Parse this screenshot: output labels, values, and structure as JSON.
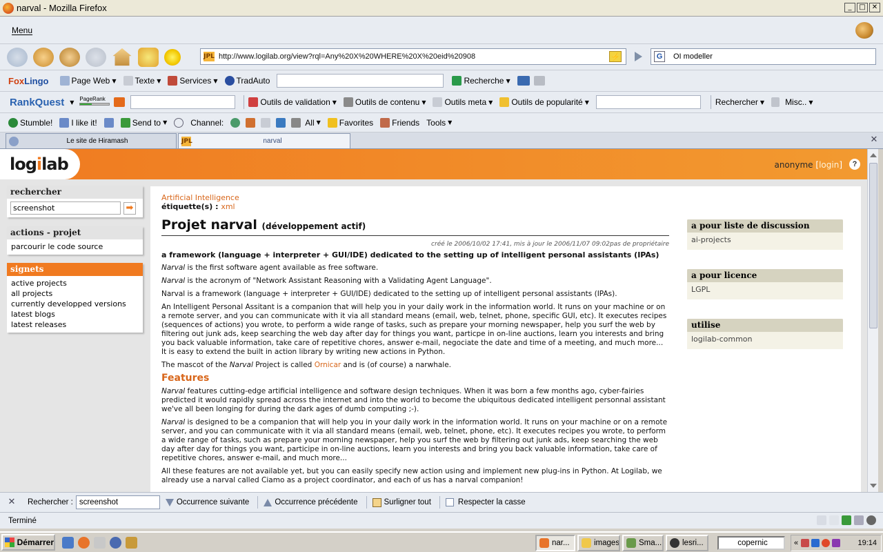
{
  "window": {
    "title": "narval - Mozilla Firefox",
    "btn_min": "_",
    "btn_max": "□",
    "btn_close": "✕"
  },
  "menubar": {
    "menu_label": "Menu"
  },
  "navbar": {
    "url": "http://www.logilab.org/view?rql=Any%20X%20WHERE%20X%20eid%20908",
    "url_favicon": "JPL",
    "lightning": "⚡",
    "search_engine": "G",
    "search_text": "OI modeller"
  },
  "toolbar1": {
    "foxlingo_a": "Fox",
    "foxlingo_b": "Lingo",
    "items": [
      "Page Web",
      "Texte",
      "Services",
      "TradAuto"
    ],
    "recherche": "Recherche"
  },
  "toolbar2": {
    "rankquest": "RankQuest",
    "pagerank": "PageRank",
    "items": [
      "Outils de validation",
      "Outils de contenu",
      "Outils meta",
      "Outils de popularité"
    ],
    "rechercher": "Rechercher",
    "misc": "Misc.."
  },
  "toolbar3": {
    "stumble": "Stumble!",
    "ilike": "I like it!",
    "sendto": "Send to",
    "channel": "Channel:",
    "all": "All",
    "favorites": "Favorites",
    "friends": "Friends",
    "tools": "Tools"
  },
  "tabs": [
    {
      "label": "Le site de Hiramash"
    },
    {
      "label": "narval",
      "favicon": "JPL"
    }
  ],
  "site": {
    "logo_a": "log",
    "logo_i": "i",
    "logo_b": "lab",
    "user": "anonyme",
    "open_bracket": "[",
    "login": "login",
    "close_bracket": "]",
    "help": "?"
  },
  "sidebar": {
    "search_title": "rechercher",
    "search_value": "screenshot",
    "search_go": "➡",
    "actions_title": "actions - projet",
    "actions": [
      "parcourir le code source"
    ],
    "signets_title": "signets",
    "signets": [
      "active projects",
      "all projects",
      "currently developped versions",
      "latest blogs",
      "latest releases"
    ]
  },
  "article": {
    "category": "Artificial Intelligence",
    "tags_label": "étiquette(s) :",
    "tags_value": "xml",
    "title": "Projet narval",
    "state": "(développement actif)",
    "meta": "créé le 2006/10/02 17:41, mis à jour le 2006/11/07 09:02pas de propriétaire",
    "summary": "a framework (language + interpreter + GUI/IDE) dedicated to the setting up of intelligent personal assistants (IPAs)",
    "p1_em": "Narval",
    "p1_rest": " is the first software agent available as free software.",
    "p2_em": "Narval",
    "p2_rest": " is the acronym of \"Network Assistant Reasoning with a Validating Agent Language\".",
    "p3": "Narval is a framework (language + interpreter + GUI/IDE) dedicated to the setting up of intelligent personal assistants (IPAs).",
    "p4": "An Intelligent Personal Assitant is a companion that will help you in your daily work in the information world. It runs on your machine or on a remote server, and you can communicate with it via all standard means (email, web, telnet, phone, specific GUI, etc). It executes recipes (sequences of actions) you wrote, to perform a wide range of tasks, such as prepare your morning newspaper, help you surf the web by filtering out junk ads, keep searching the web day after day for things you want, particpe in on-line auctions, learn you interests and bring you back valuable information, take care of repetitive chores, answer e-mail, negociate the date and time of a meeting, and much more... It is easy to extend the built in action library by writing new actions in Python.",
    "p5_a": "The mascot of the ",
    "p5_em": "Narval",
    "p5_b": " Project is called ",
    "p5_link": "Ornicar",
    "p5_c": " and is (of course) a narwhale.",
    "features_title": "Features",
    "f1_em": "Narval",
    "f1_rest": " features cutting-edge artificial intelligence and software design techniques. When it was born a few months ago, cyber-fairies predicted it would rapidly spread across the internet and into the world to become the ubiquitous dedicated intelligent personnal assistant we've all been longing for during the dark ages of dumb computing ;-).",
    "f2_em": "Narval",
    "f2_rest": " is designed to be a companion that will help you in your daily work in the information world. It runs on your machine or on a remote server, and you can communicate with it via all standard means (email, web, telnet, phone, etc). It executes recipes you wrote, to perform a wide range of tasks, such as prepare your morning newspaper, help you surf the web by filtering out junk ads, keep searching the web day after day for things you want, participe in on-line auctions, learn you interests and bring you back valuable information, take care of repetitive chores, answer e-mail, and much more...",
    "f3": "All these features are not available yet, but you can easily specify new action using and implement new plug-ins in Python. At Logilab, we already use a narval called Ciamo as a project coordinator, and each of us has a narval companion!"
  },
  "rightboxes": [
    {
      "title": "a pour liste de discussion",
      "value": "ai-projects"
    },
    {
      "title": "a pour licence",
      "value": "LGPL"
    },
    {
      "title": "utilise",
      "value": "logilab-common"
    }
  ],
  "findbar": {
    "close": "✕",
    "label": "Rechercher :",
    "value": "screenshot",
    "next": "Occurrence suivante",
    "prev": "Occurrence précédente",
    "highlight": "Surligner tout",
    "matchcase": "Respecter la casse"
  },
  "statusbar": {
    "text": "Terminé"
  },
  "taskbar": {
    "start": "Démarrer",
    "items": [
      "nar...",
      "images",
      "Sma...",
      "lesri..."
    ],
    "tray_input": "copernic",
    "tray_arrows": "«",
    "clock": "19:14"
  }
}
